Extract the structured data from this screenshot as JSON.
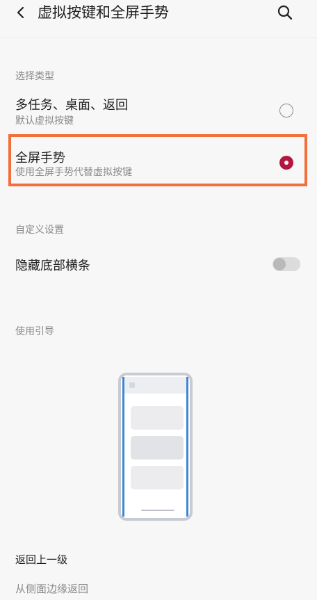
{
  "header": {
    "title": "虚拟按键和全屏手势",
    "back_icon": "chevron-left-icon",
    "search_icon": "search-icon"
  },
  "section_type": {
    "label": "选择类型",
    "options": [
      {
        "title": "多任务、桌面、返回",
        "subtitle": "默认虚拟按键",
        "selected": false
      },
      {
        "title": "全屏手势",
        "subtitle": "使用全屏手势代替虚拟按键",
        "selected": true
      }
    ]
  },
  "section_custom": {
    "label": "自定义设置",
    "hide_bar": {
      "label": "隐藏底部横条",
      "enabled": false
    }
  },
  "section_guide": {
    "label": "使用引导",
    "illustration": "phone-gesture-illustration"
  },
  "gesture_help": {
    "title": "返回上一级",
    "description": "从侧面边缘返回"
  },
  "colors": {
    "accent": "#b5163f",
    "highlight_border": "#f26f3a",
    "edge_indicator": "#3d86d6"
  }
}
